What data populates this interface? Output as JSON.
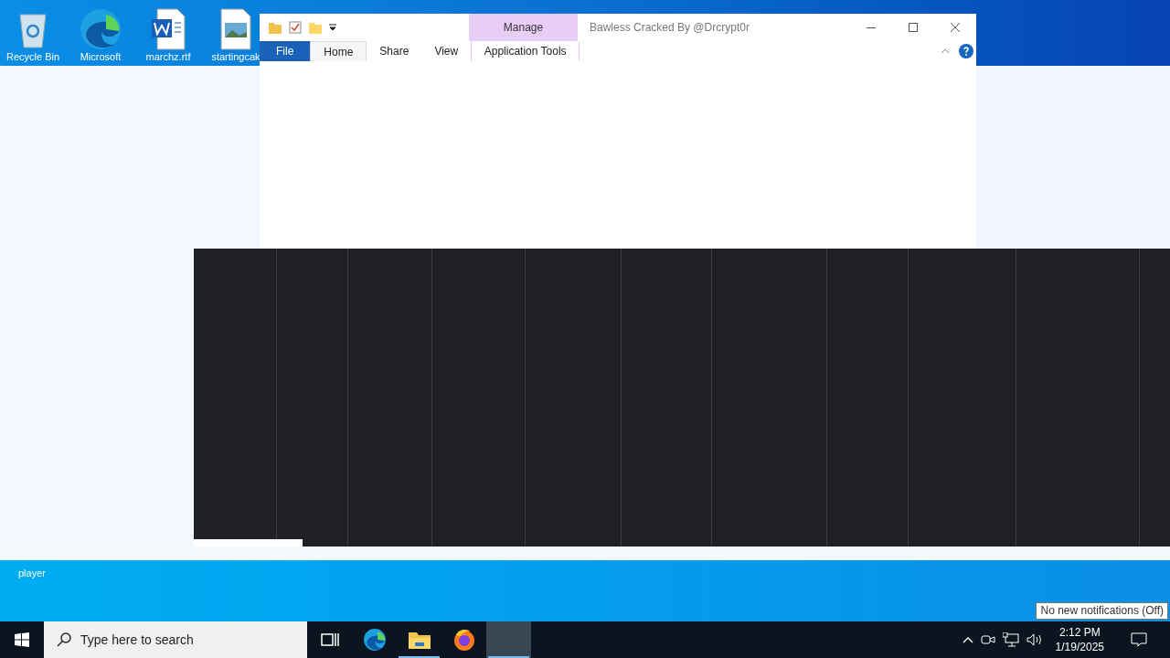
{
  "desktop_icons": [
    {
      "kind": "recycle",
      "label": "Recycle Bin"
    },
    {
      "kind": "edge",
      "label": "Microsoft"
    },
    {
      "kind": "word",
      "label": "marchz.rtf"
    },
    {
      "kind": "image",
      "label": "startingcak"
    }
  ],
  "window": {
    "title": "Bawless Cracked By @Drcrypt0r",
    "context_group": "Manage",
    "tabs": [
      {
        "label": "File",
        "kind": "file",
        "selected": false
      },
      {
        "label": "Home",
        "kind": "tab",
        "selected": true
      },
      {
        "label": "Share",
        "kind": "tab",
        "selected": false
      },
      {
        "label": "View",
        "kind": "tab",
        "selected": false
      },
      {
        "label": "Application Tools",
        "kind": "context",
        "selected": false
      }
    ]
  },
  "desktop_label": "player",
  "taskbar": {
    "search_placeholder": "Type here to search",
    "apps": [
      {
        "kind": "taskview",
        "running": false,
        "selected": false
      },
      {
        "kind": "edge",
        "running": false,
        "selected": false
      },
      {
        "kind": "explorer",
        "running": true,
        "selected": false
      },
      {
        "kind": "firefox",
        "running": false,
        "selected": false
      },
      {
        "kind": "blank",
        "running": true,
        "selected": true
      }
    ],
    "time": "2:12 PM",
    "date": "1/19/2025",
    "tooltip": "No new notifications (Off)"
  }
}
